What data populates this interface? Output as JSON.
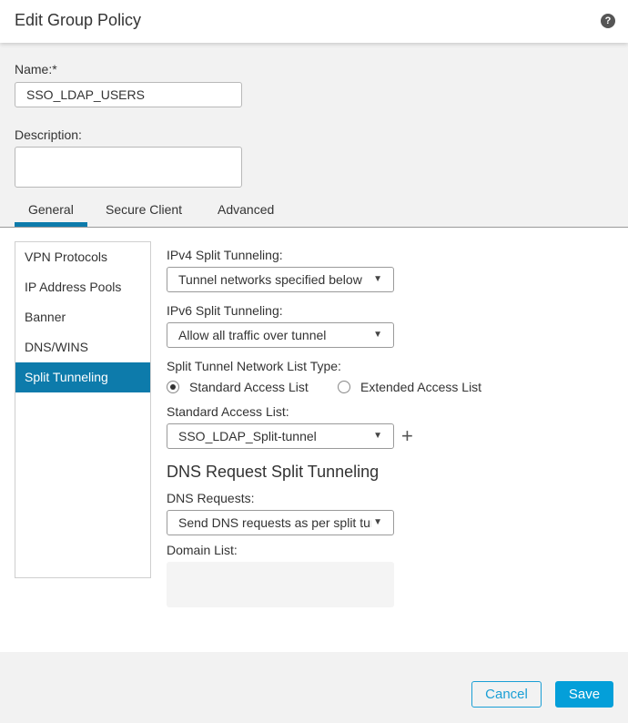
{
  "dialog": {
    "title": "Edit Group Policy",
    "help_icon": "?"
  },
  "form": {
    "name_label": "Name:*",
    "name_value": "SSO_LDAP_USERS",
    "description_label": "Description:",
    "description_value": ""
  },
  "tabs": [
    {
      "label": "General",
      "active": true
    },
    {
      "label": "Secure Client",
      "active": false
    },
    {
      "label": "Advanced",
      "active": false
    }
  ],
  "sidebar": {
    "items": [
      {
        "label": "VPN Protocols",
        "active": false
      },
      {
        "label": "IP Address Pools",
        "active": false
      },
      {
        "label": "Banner",
        "active": false
      },
      {
        "label": "DNS/WINS",
        "active": false
      },
      {
        "label": "Split Tunneling",
        "active": true
      }
    ]
  },
  "split_tunneling": {
    "ipv4_label": "IPv4 Split Tunneling:",
    "ipv4_value": "Tunnel networks specified below",
    "ipv6_label": "IPv6 Split Tunneling:",
    "ipv6_value": "Allow all traffic over tunnel",
    "list_type_label": "Split Tunnel Network List Type:",
    "list_type_options": [
      {
        "label": "Standard Access List",
        "checked": true
      },
      {
        "label": "Extended Access List",
        "checked": false
      }
    ],
    "standard_acl_label": "Standard Access List:",
    "standard_acl_value": "SSO_LDAP_Split-tunnel",
    "add_icon": "+",
    "dns_section_title": "DNS Request Split Tunneling",
    "dns_requests_label": "DNS Requests:",
    "dns_requests_value": "Send DNS requests as per split tunnel policy",
    "domain_list_label": "Domain List:",
    "domain_list_value": ""
  },
  "footer": {
    "cancel_label": "Cancel",
    "save_label": "Save"
  },
  "icons": {
    "caret": "▼"
  },
  "colors": {
    "accent": "#0d7bab",
    "primary_button": "#049fd9"
  }
}
